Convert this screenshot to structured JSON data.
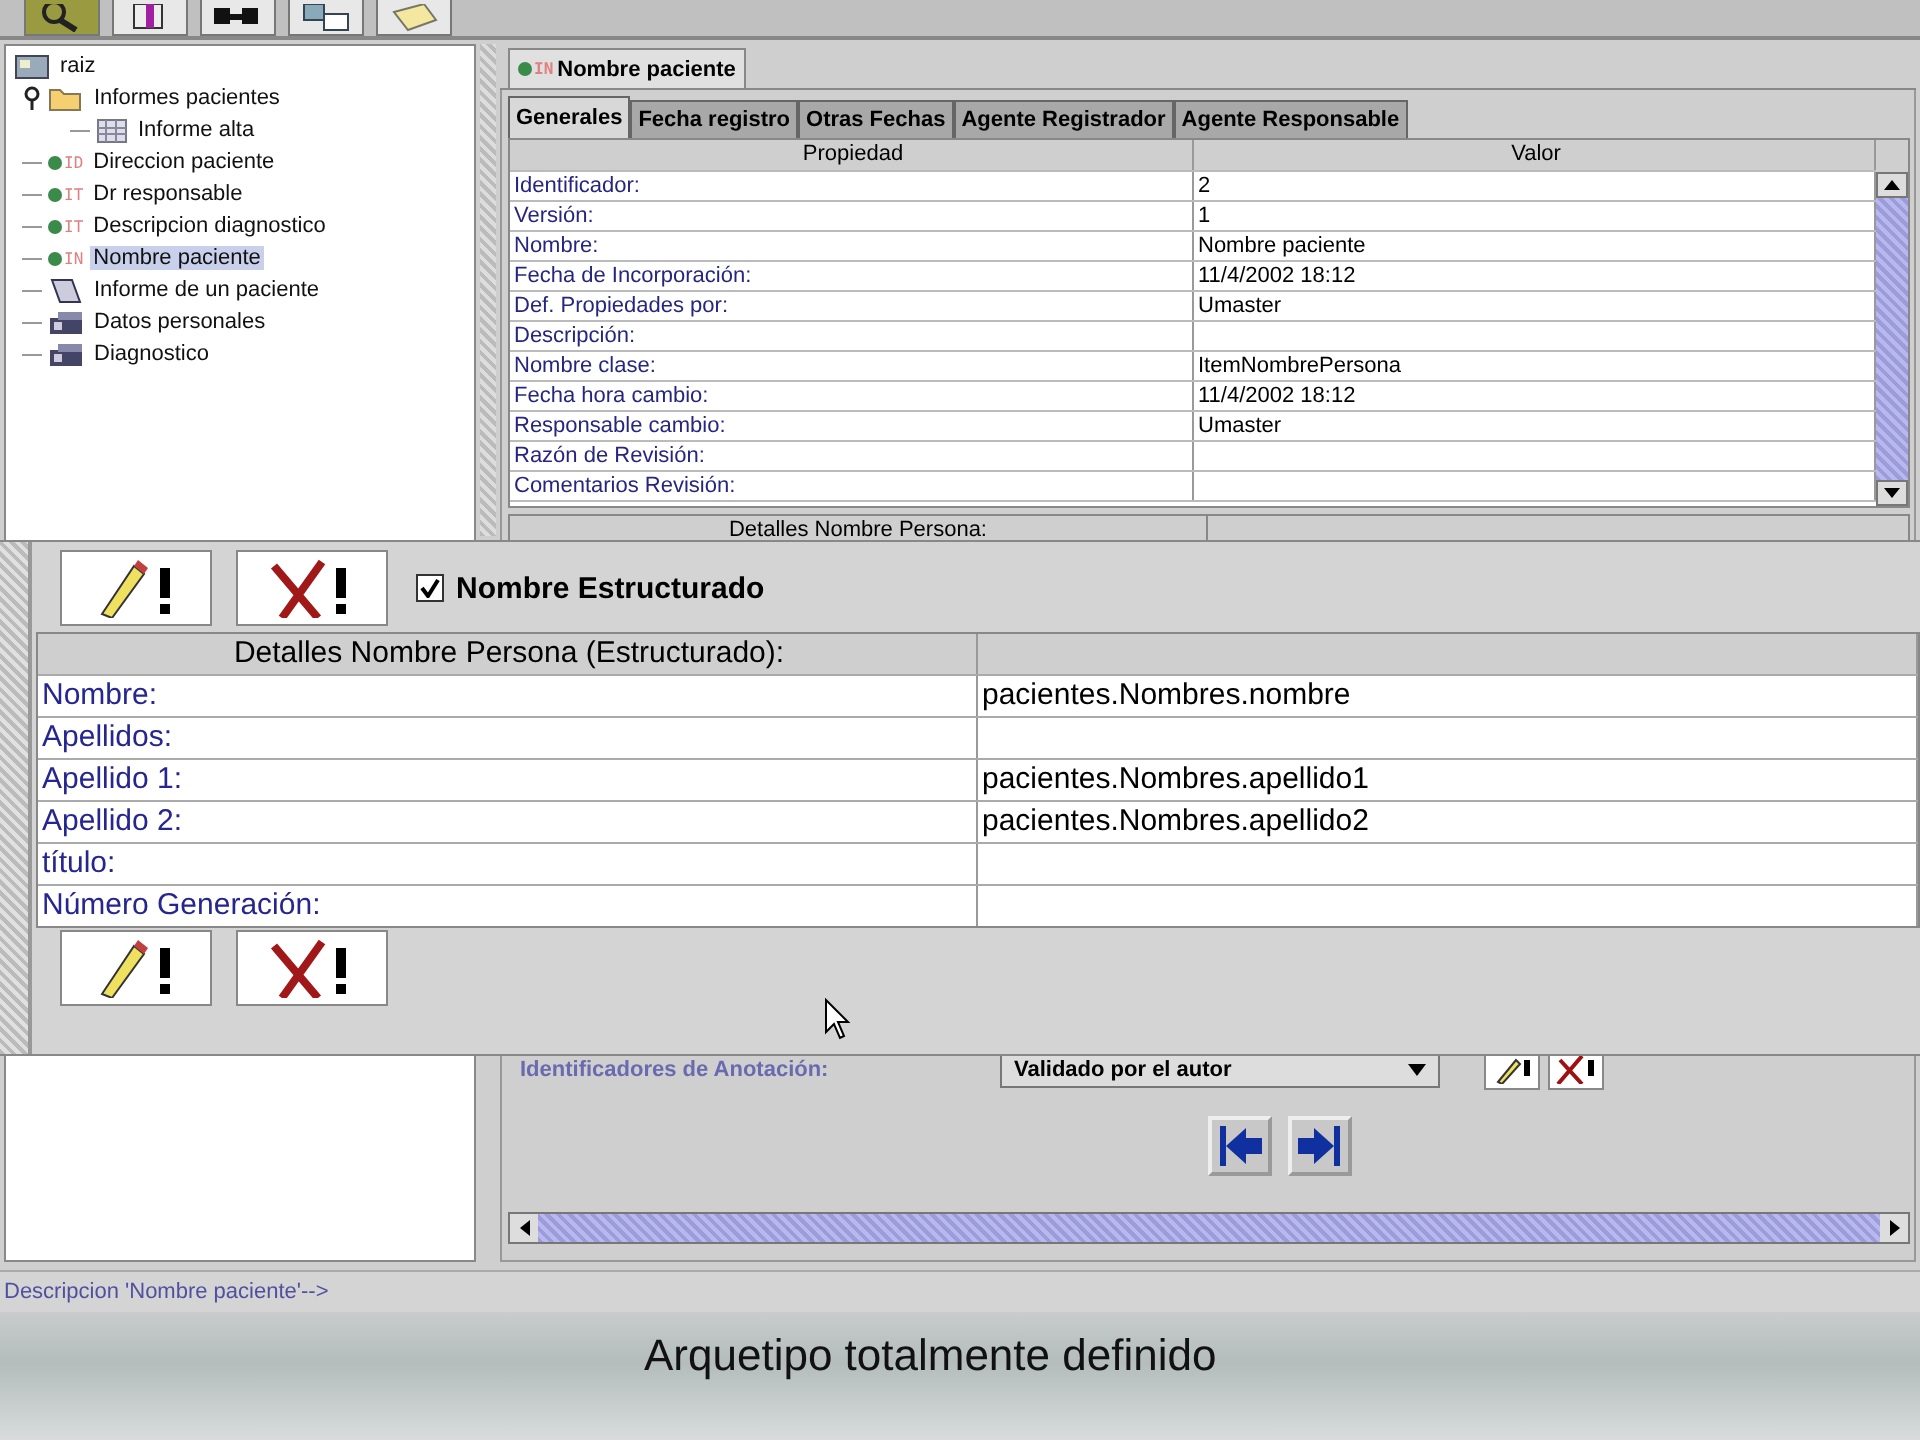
{
  "toolbar": {
    "buttons": [
      {
        "kind": "search",
        "selected": true
      },
      {
        "kind": "cube",
        "selected": false
      },
      {
        "kind": "network",
        "selected": false
      },
      {
        "kind": "table",
        "selected": false
      },
      {
        "kind": "note",
        "selected": false
      }
    ]
  },
  "tree": {
    "root": {
      "label": "raiz",
      "kind": "root",
      "children": [
        {
          "label": "Informes pacientes",
          "kind": "folder",
          "expanded": true,
          "children": [
            {
              "label": "Informe alta",
              "kind": "table",
              "selected": false
            }
          ],
          "selected": false
        },
        {
          "label": "Direccion paciente",
          "kind": "item",
          "tag": "ID",
          "selected": false
        },
        {
          "label": "Dr responsable",
          "kind": "item",
          "tag": "IT",
          "selected": false
        },
        {
          "label": "Descripcion diagnostico",
          "kind": "item",
          "tag": "IT",
          "selected": false
        },
        {
          "label": "Nombre paciente",
          "kind": "item",
          "tag": "IN",
          "selected": true
        },
        {
          "label": "Informe de un paciente",
          "kind": "report",
          "selected": false
        },
        {
          "label": "Datos personales",
          "kind": "form",
          "selected": false
        },
        {
          "label": "Diagnostico",
          "kind": "form",
          "selected": false
        }
      ]
    }
  },
  "document_tab": {
    "label": "Nombre paciente",
    "tag": "IN"
  },
  "tabs": [
    {
      "label": "Generales",
      "selected": true
    },
    {
      "label": "Fecha registro",
      "selected": false
    },
    {
      "label": "Otras Fechas",
      "selected": false
    },
    {
      "label": "Agente Registrador",
      "selected": false
    },
    {
      "label": "Agente Responsable",
      "selected": false
    }
  ],
  "properties_table": {
    "columns": [
      "Propiedad",
      "Valor"
    ],
    "rows": [
      [
        "Identificador:",
        "2"
      ],
      [
        "Versión:",
        "1"
      ],
      [
        "Nombre:",
        "Nombre paciente"
      ],
      [
        "Fecha de Incorporación:",
        "11/4/2002 18:12"
      ],
      [
        "Def. Propiedades por:",
        "Umaster"
      ],
      [
        "Descripción:",
        ""
      ],
      [
        "Nombre clase:",
        "ItemNombrePersona"
      ],
      [
        "Fecha hora cambio:",
        "11/4/2002 18:12"
      ],
      [
        "Responsable cambio:",
        "Umaster"
      ],
      [
        "Razón de Revisión:",
        ""
      ],
      [
        "Comentarios Revisión:",
        ""
      ]
    ]
  },
  "details_header": "Detalles Nombre Persona:",
  "structured_panel": {
    "checkbox": {
      "label": "Nombre Estructurado",
      "checked": true
    },
    "table": {
      "columns": [
        "Detalles Nombre Persona (Estructurado):"
      ],
      "rows": [
        [
          "Nombre:",
          "pacientes.Nombres.nombre"
        ],
        [
          "Apellidos:",
          ""
        ],
        [
          "Apellido 1:",
          "pacientes.Nombres.apellido1"
        ],
        [
          "Apellido 2:",
          "pacientes.Nombres.apellido2"
        ],
        [
          "título:",
          ""
        ],
        [
          "Número Generación:",
          ""
        ]
      ]
    }
  },
  "annotation": {
    "label": "Identificadores de Anotación:",
    "value": "Validado por el autor"
  },
  "status_bar": "Descripcion 'Nombre paciente'-->",
  "caption": "Arquetipo totalmente definido"
}
